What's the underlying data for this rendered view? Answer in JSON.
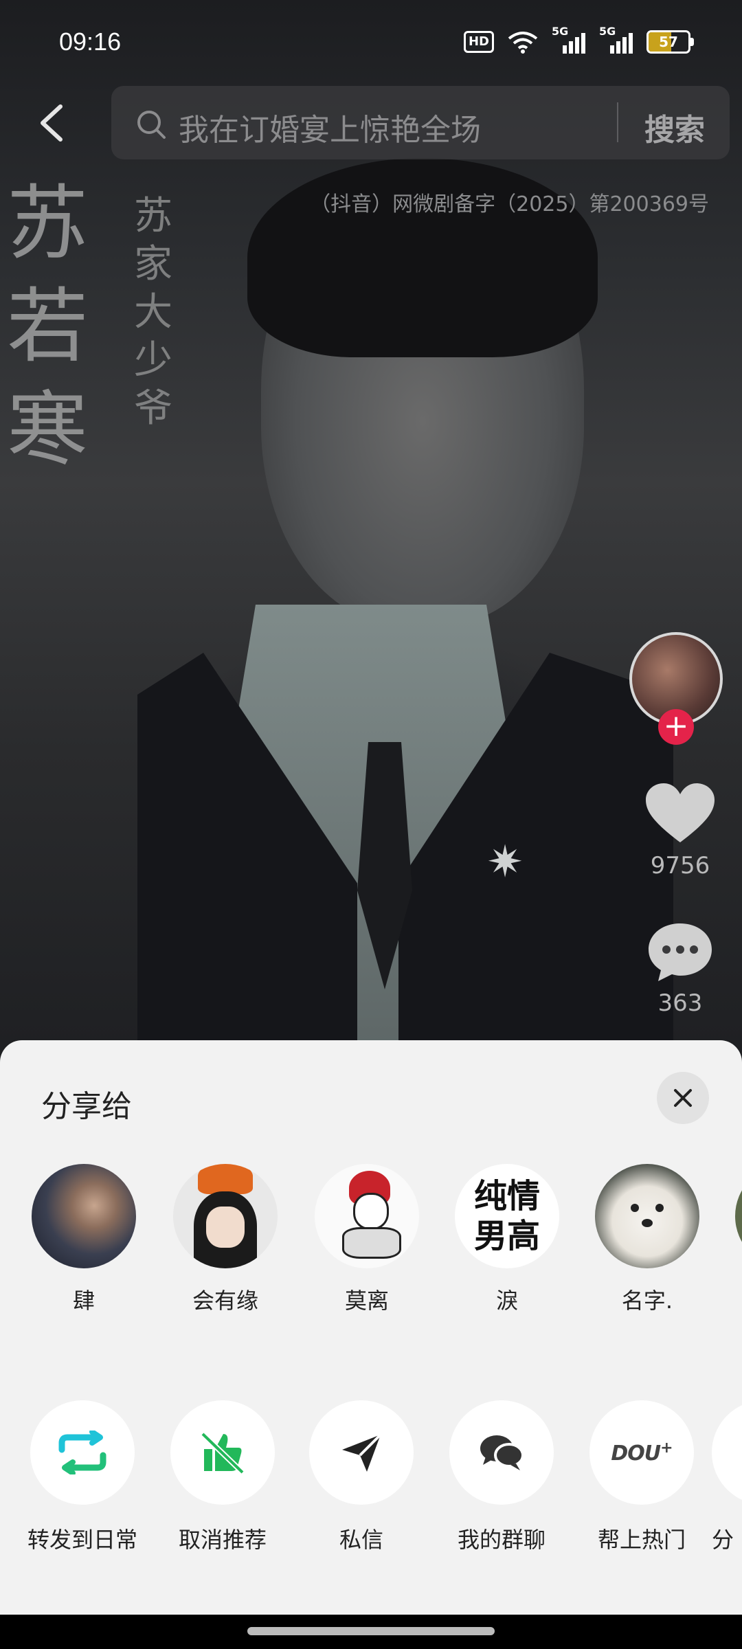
{
  "status_bar": {
    "time": "09:16",
    "hd_label": "HD",
    "network_1": "5G",
    "network_2": "5G",
    "battery": "57",
    "battery_level": 0.57,
    "battery_color": "#c8a21c"
  },
  "search": {
    "placeholder": "我在订婚宴上惊艳全场",
    "button": "搜索"
  },
  "video": {
    "calligraphy_name": "苏若寒",
    "calligraphy_title": "苏家大少爷",
    "license": "（抖音）网微剧备字（2025）第200369号"
  },
  "side_actions": {
    "likes": "9756",
    "comments": "363",
    "follow_icon": "plus-icon"
  },
  "share_sheet": {
    "title": "分享给",
    "contacts": [
      {
        "name": "肆"
      },
      {
        "name": "会有缘"
      },
      {
        "name": "莫离"
      },
      {
        "name": "淚",
        "avatar_text_1": "纯情",
        "avatar_text_2": "男高"
      },
      {
        "name": "名字."
      }
    ],
    "actions": [
      {
        "label": "转发到日常",
        "icon": "repost-icon"
      },
      {
        "label": "取消推荐",
        "icon": "cancel-recommend-icon"
      },
      {
        "label": "私信",
        "icon": "send-icon"
      },
      {
        "label": "我的群聊",
        "icon": "group-chat-icon"
      },
      {
        "label": "帮上热门",
        "icon": "dou-plus-icon",
        "icon_text": "DOU"
      },
      {
        "label": "分",
        "icon": "more-share-icon"
      }
    ]
  },
  "colors": {
    "accent_red": "#e4234a",
    "repost_cyan": "#1fc3d8",
    "green": "#22b85a"
  }
}
